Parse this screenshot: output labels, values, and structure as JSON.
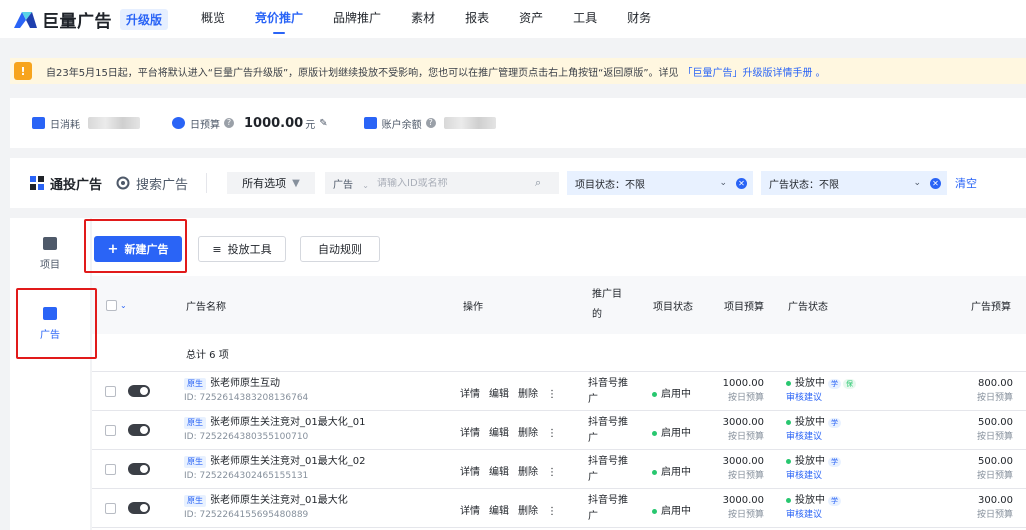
{
  "topnav": {
    "logo_text": "巨量广告",
    "badge": "升级版",
    "items": [
      "概览",
      "竞价推广",
      "品牌推广",
      "素材",
      "报表",
      "资产",
      "工具",
      "财务"
    ],
    "active_index": 1
  },
  "notice": {
    "icon": "!",
    "text": "自23年5月15日起，平台将默认进入“巨量广告升级版”，原版计划继续投放不受影响，您也可以在推广管理页点击右上角按钮“返回原版”。详见",
    "link": "「巨量广告」升级版详情手册",
    "tail": "。"
  },
  "stats": {
    "daily_spend_label": "日消耗",
    "daily_budget_label": "日预算",
    "daily_budget_value": "1000.00",
    "daily_budget_unit": "元",
    "balance_label": "账户余额"
  },
  "filter": {
    "tab_active": "通投广告",
    "tab_inactive": "搜索广告",
    "all_options": "所有选项",
    "search_type": "广告",
    "search_placeholder": "请输入ID或名称",
    "project_status": "项目状态：不限",
    "ad_status": "广告状态：不限",
    "clear": "清空"
  },
  "rail": {
    "items": [
      {
        "label": "项目",
        "icon": "folder-icon"
      },
      {
        "label": "广告",
        "icon": "ad-doc-icon"
      }
    ],
    "active_index": 1
  },
  "toolbar": {
    "new_ad": "新建广告",
    "new_ad_plus": "+",
    "tools": "投放工具",
    "auto_rules": "自动规则"
  },
  "table": {
    "headers": {
      "name": "广告名称",
      "ops": "操作",
      "purpose_l1": "推广目",
      "purpose_l2": "的",
      "project_status": "项目状态",
      "project_budget": "项目预算",
      "ad_status": "广告状态",
      "ad_budget": "广告预算"
    },
    "total": "总计 6 项",
    "tag": "原生",
    "op_detail": "详情",
    "op_edit": "编辑",
    "op_delete": "删除",
    "op_more": "⋮",
    "rows": [
      {
        "name": "张老师原生互动",
        "id": "ID: 7252614383208136764",
        "purpose_l1": "抖音号推",
        "purpose_l2": "广",
        "project_status": "启用中",
        "project_budget": "1000.00",
        "budget_type": "按日预算",
        "ad_status": "投放中",
        "learn": "学",
        "safe": "保",
        "review": "审核建议",
        "ad_budget": "800.00",
        "ad_budget_type": "按日预算"
      },
      {
        "name": "张老师原生关注竞对_01最大化_01",
        "id": "ID: 7252264380355100710",
        "purpose_l1": "抖音号推",
        "purpose_l2": "广",
        "project_status": "启用中",
        "project_budget": "3000.00",
        "budget_type": "按日预算",
        "ad_status": "投放中",
        "learn": "学",
        "safe": "",
        "review": "审核建议",
        "ad_budget": "500.00",
        "ad_budget_type": "按日预算"
      },
      {
        "name": "张老师原生关注竞对_01最大化_02",
        "id": "ID: 7252264302465155131",
        "purpose_l1": "抖音号推",
        "purpose_l2": "广",
        "project_status": "启用中",
        "project_budget": "3000.00",
        "budget_type": "按日预算",
        "ad_status": "投放中",
        "learn": "学",
        "safe": "",
        "review": "审核建议",
        "ad_budget": "500.00",
        "ad_budget_type": "按日预算"
      },
      {
        "name": "张老师原生关注竞对_01最大化",
        "id": "ID: 7252264155695480889",
        "purpose_l1": "抖音号推",
        "purpose_l2": "广",
        "project_status": "启用中",
        "project_budget": "3000.00",
        "budget_type": "按日预算",
        "ad_status": "投放中",
        "learn": "学",
        "safe": "",
        "review": "审核建议",
        "ad_budget": "300.00",
        "ad_budget_type": "按日预算"
      }
    ]
  },
  "colors": {
    "primary": "#2a64f6",
    "highlight": "#e11a1a",
    "status_green": "#28c76f",
    "notice_bg": "#fff7e0"
  }
}
